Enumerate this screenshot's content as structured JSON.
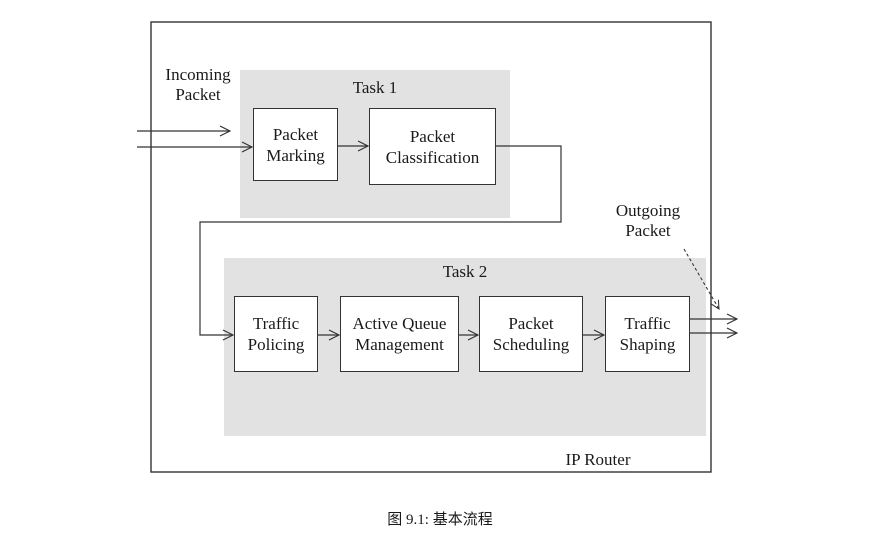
{
  "router": {
    "label": "IP Router"
  },
  "incoming": {
    "label": "Incoming\nPacket"
  },
  "outgoing": {
    "label": "Outgoing\nPacket"
  },
  "task1": {
    "title": "Task 1",
    "boxes": [
      "Packet\nMarking",
      "Packet\nClassification"
    ]
  },
  "task2": {
    "title": "Task 2",
    "boxes": [
      "Traffic\nPolicing",
      "Active Queue\nManagement",
      "Packet\nScheduling",
      "Traffic\nShaping"
    ]
  },
  "caption": "图 9.1: 基本流程",
  "colors": {
    "task_region": "#e2e2e2",
    "line": "#333333",
    "box_fill": "#ffffff"
  }
}
